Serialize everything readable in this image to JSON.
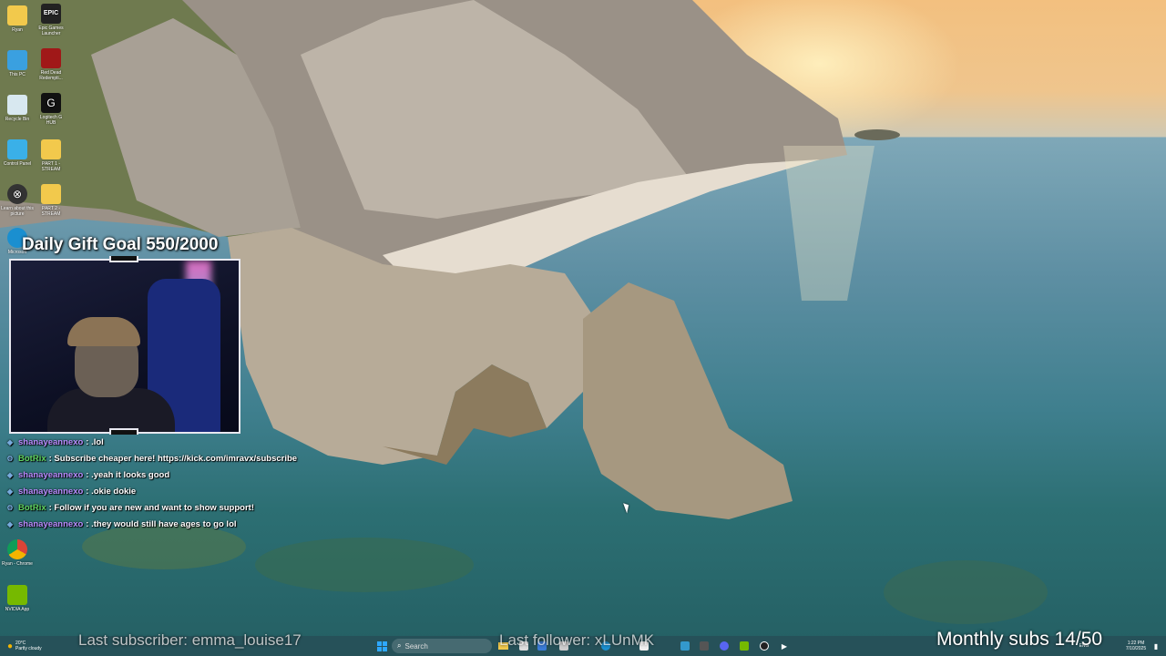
{
  "desktop": {
    "icons": [
      {
        "label": "Ryan",
        "icon": "folder-icon"
      },
      {
        "label": "Epic Games Launcher",
        "icon": "epic-games-icon"
      },
      {
        "label": "This PC",
        "icon": "computer-icon"
      },
      {
        "label": "Red Dead Redempti...",
        "icon": "red-dead-icon"
      },
      {
        "label": "Recycle Bin",
        "icon": "recycle-bin-icon"
      },
      {
        "label": "Logitech G HUB",
        "icon": "logitech-icon"
      },
      {
        "label": "Control Panel",
        "icon": "control-panel-icon"
      },
      {
        "label": "PART 1 - STREAM",
        "icon": "folder-icon"
      },
      {
        "label": "Learn about this picture",
        "icon": "camera-icon"
      },
      {
        "label": "PART 2 - STREAM",
        "icon": "folder-icon"
      },
      {
        "label": "Microsoft",
        "icon": "edge-icon"
      },
      {
        "label": "Ryan - Chrome",
        "icon": "chrome-icon"
      },
      {
        "label": "NVIDIA App",
        "icon": "nvidia-icon"
      }
    ]
  },
  "stream_overlay": {
    "gift_goal": "Daily Gift Goal 550/2000",
    "last_subscriber": "Last subscriber: emma_louise17",
    "last_follower": "Last follower: xLUnMK",
    "monthly_subs": "Monthly subs 14/50"
  },
  "chat": [
    {
      "user": "shanayeannexo",
      "message": ": .lol",
      "user_color": "#b98cff"
    },
    {
      "user": "BotRix",
      "message": ": Subscribe cheaper here! https://kick.com/imravx/subscribe",
      "user_color": "#5fd15f"
    },
    {
      "user": "shanayeannexo",
      "message": ": .yeah it looks good",
      "user_color": "#b98cff"
    },
    {
      "user": "shanayeannexo",
      "message": ": .okie dokie",
      "user_color": "#b98cff"
    },
    {
      "user": "BotRix",
      "message": ": Follow if you are new and want to show support!",
      "user_color": "#5fd15f"
    },
    {
      "user": "shanayeannexo",
      "message": ": .they would still have ages to go lol",
      "user_color": "#b98cff"
    }
  ],
  "taskbar": {
    "weather_temp": "20°C",
    "weather_text": "Partly cloudy",
    "search_placeholder": "Search",
    "time": "1:22 PM",
    "date": "7/10/2025",
    "lang": "ENG"
  }
}
